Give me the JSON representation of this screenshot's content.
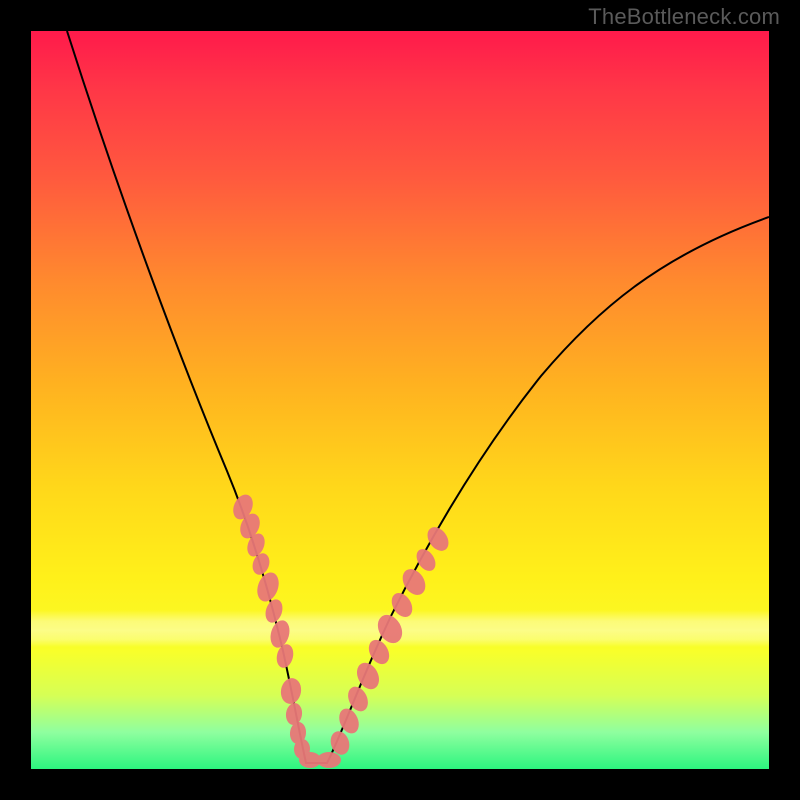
{
  "watermark": "TheBottleneck.com",
  "chart_data": {
    "type": "line",
    "title": "",
    "xlabel": "",
    "ylabel": "",
    "xlim": [
      0,
      100
    ],
    "ylim": [
      0,
      100
    ],
    "series": [
      {
        "name": "bottleneck-curve",
        "x": [
          5,
          10,
          15,
          20,
          22,
          24,
          26,
          28,
          30,
          32,
          34,
          35,
          38,
          40,
          43,
          47,
          50,
          55,
          60,
          65,
          70,
          75,
          80,
          85,
          90,
          95,
          100
        ],
        "values": [
          100,
          82,
          67,
          52,
          46,
          40,
          34,
          26,
          18,
          11,
          4,
          0,
          0,
          0,
          3,
          8,
          13,
          20,
          28,
          35,
          42,
          48,
          53,
          58,
          62,
          66,
          70
        ]
      }
    ],
    "highlight_clusters": [
      {
        "name": "left-highlight",
        "x_range": [
          26.2,
          32.2
        ],
        "axis_value_range": [
          11,
          36
        ]
      },
      {
        "name": "valley-highlight",
        "x_range": [
          33.5,
          40.0
        ],
        "axis_value_range": [
          0,
          5
        ]
      },
      {
        "name": "right-highlight",
        "x_range": [
          42.0,
          52.5
        ],
        "axis_value_range": [
          3,
          19
        ]
      }
    ],
    "gradient_scale": {
      "description": "vertical color gradient red (high bottleneck) to green (low)",
      "stops": [
        {
          "pos": 0,
          "color": "#ff1a4b"
        },
        {
          "pos": 20,
          "color": "#ff5a3e"
        },
        {
          "pos": 48,
          "color": "#ffb220"
        },
        {
          "pos": 74,
          "color": "#fff01a"
        },
        {
          "pos": 90,
          "color": "#d6ff55"
        },
        {
          "pos": 100,
          "color": "#2cf57f"
        }
      ]
    }
  }
}
